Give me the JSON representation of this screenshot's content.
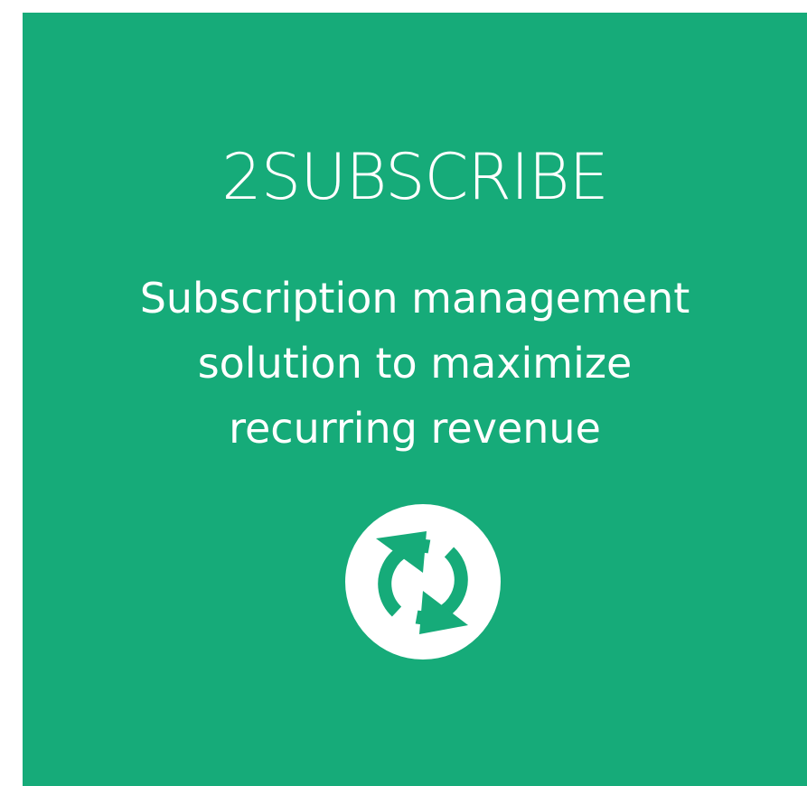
{
  "card": {
    "background_color": "#16ab79",
    "title": "2SUBSCRIBE",
    "tagline_lines": [
      "Subscription management",
      "solution to maximize",
      "recurring revenue"
    ],
    "icon": "refresh-cycle-icon"
  }
}
